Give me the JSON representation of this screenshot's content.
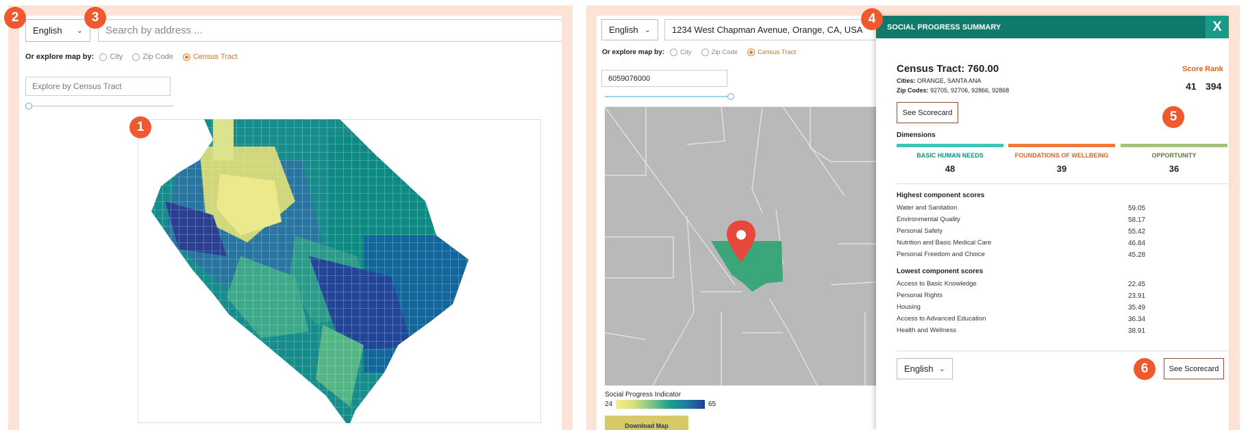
{
  "left": {
    "language": "English",
    "search_placeholder": "Search by address ...",
    "explore_label": "Or explore map by:",
    "options": [
      "City",
      "Zip Code",
      "Census Tract"
    ],
    "selected_option": "Census Tract",
    "tract_placeholder": "Explore by Census Tract"
  },
  "right": {
    "language": "English",
    "address_value": "1234 West Chapman Avenue, Orange, CA, USA",
    "explore_label": "Or explore map by:",
    "options": [
      "City",
      "Zip Code",
      "Census Tract"
    ],
    "selected_option": "Census Tract",
    "tract_value": "6059076000",
    "legend_title": "Social Progress Indicator",
    "legend_min": "24",
    "legend_max": "65",
    "download_label": "Download Map"
  },
  "summary": {
    "title": "SOCIAL PROGRESS SUMMARY",
    "close": "X",
    "tract": "Census Tract: 760.00",
    "cities_label": "Cities:",
    "cities": "ORANGE, SANTA ANA",
    "zips_label": "Zip Codes:",
    "zips": "92705, 92706, 92866, 92868",
    "score_label": "Score",
    "rank_label": "Rank",
    "score": "41",
    "rank": "394",
    "scorecard_label": "See Scorecard",
    "dimensions_label": "Dimensions",
    "dimensions": [
      {
        "label": "BASIC HUMAN NEEDS",
        "value": "48",
        "color": "#3cc7b5",
        "text_color": "#0f8f7c"
      },
      {
        "label": "FOUNDATIONS OF WELLBEING",
        "value": "39",
        "color": "#ef7a3a",
        "text_color": "#e0621f"
      },
      {
        "label": "OPPORTUNITY",
        "value": "36",
        "color": "#a3c27a",
        "text_color": "#5a7a3a"
      }
    ],
    "highest_label": "Highest component scores",
    "highest": [
      {
        "name": "Water and Sanitation",
        "value": "59.05"
      },
      {
        "name": "Environmental Quality",
        "value": "58.17"
      },
      {
        "name": "Personal Safety",
        "value": "55.42"
      },
      {
        "name": "Nutrition and Basic Medical Care",
        "value": "46.84"
      },
      {
        "name": "Personal Freedom and Choice",
        "value": "45.28"
      }
    ],
    "lowest_label": "Lowest component scores",
    "lowest": [
      {
        "name": "Access to Basic Knowledge",
        "value": "22.45"
      },
      {
        "name": "Personal Rights",
        "value": "23.91"
      },
      {
        "name": "Housing",
        "value": "35.49"
      },
      {
        "name": "Access to Advanced Education",
        "value": "36.34"
      },
      {
        "name": "Health and Wellness",
        "value": "38.91"
      }
    ],
    "footer_language": "English",
    "footer_scorecard_label": "See Scorecard"
  },
  "badges": [
    "1",
    "2",
    "3",
    "4",
    "5",
    "6"
  ],
  "icons": {
    "chevron": "chevron-down-icon",
    "pin": "map-pin-icon"
  },
  "colors": {
    "accent": "#f0582e",
    "header": "#0f7a6b",
    "panel_bg": "#fde3d6"
  }
}
